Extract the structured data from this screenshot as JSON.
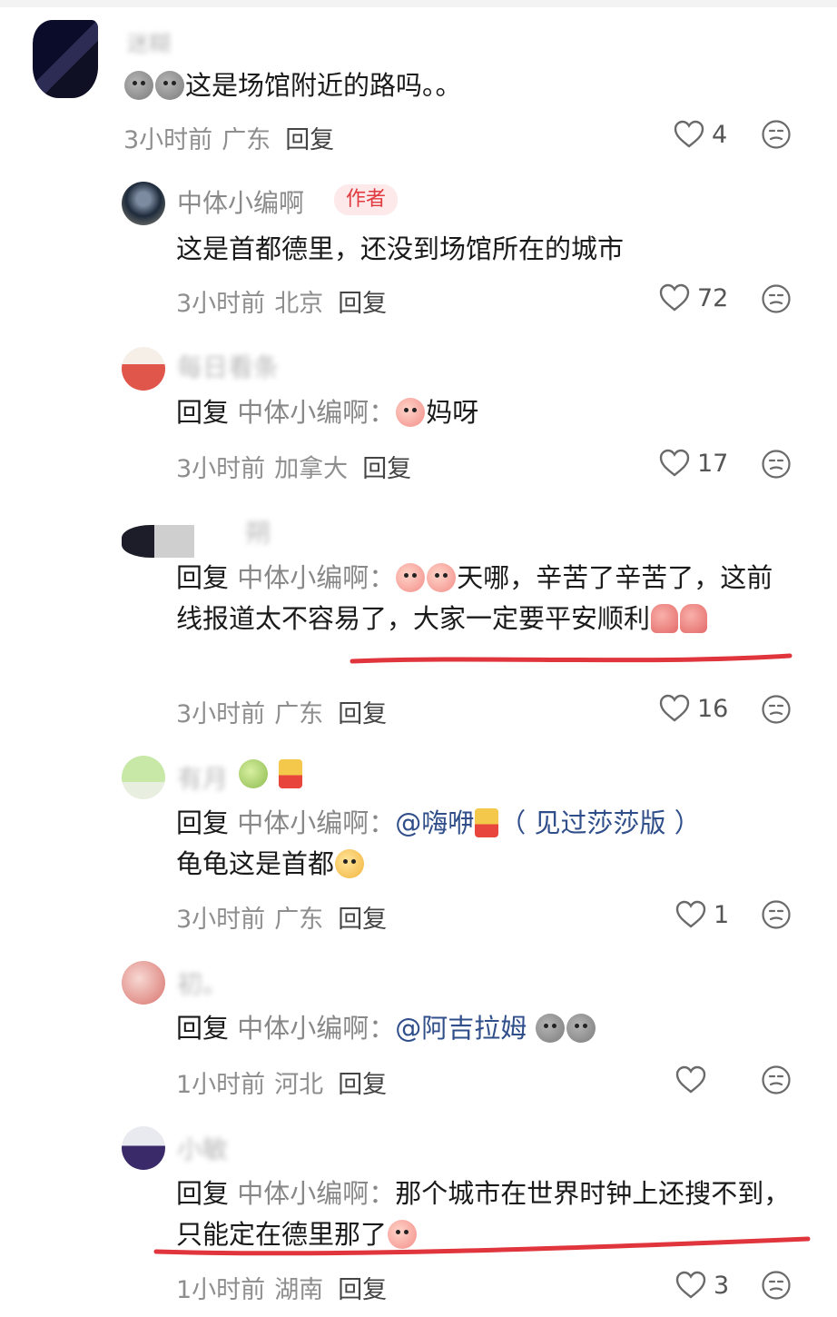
{
  "colors": {
    "like_icon": "#6a6a6a",
    "author_badge_text": "#e0393e",
    "mention": "#2f4e8a",
    "underline": "#e0353c"
  },
  "comments": [
    {
      "name": "迷糊",
      "content": "这是场馆附近的路吗。。",
      "time": "3小时前",
      "region": "广东",
      "reply_label": "回复",
      "likes": "4"
    },
    {
      "name": "中体小编啊",
      "badge": "作者",
      "content": "这是首都德里，还没到场馆所在的城市",
      "time": "3小时前",
      "region": "北京",
      "reply_label": "回复",
      "likes": "72"
    },
    {
      "name": "每日看条",
      "prefix": "回复",
      "target": "中体小编啊：",
      "content": "妈呀",
      "time": "3小时前",
      "region": "加拿大",
      "reply_label": "回复",
      "likes": "17"
    },
    {
      "name": "朔",
      "prefix": "回复",
      "target": "中体小编啊：",
      "content": "天哪，辛苦了辛苦了，这前线报道太不容易了，大家一定要平安顺利",
      "time": "3小时前",
      "region": "广东",
      "reply_label": "回复",
      "likes": "16"
    },
    {
      "name": "有月",
      "prefix": "回复",
      "target": "中体小编啊：",
      "mention": "@嗨咿",
      "content_a": "（ 见过莎莎版 ）",
      "content_b": "龟龟这是首都",
      "time": "3小时前",
      "region": "广东",
      "reply_label": "回复",
      "likes": "1"
    },
    {
      "name": "初。",
      "prefix": "回复",
      "target": "中体小编啊：",
      "mention": "@阿吉拉姆",
      "time": "1小时前",
      "region": "河北",
      "reply_label": "回复",
      "likes": ""
    },
    {
      "name": "小敏",
      "prefix": "回复",
      "target": "中体小编啊：",
      "content": "那个城市在世界时钟上还搜不到，只能定在德里那了",
      "time": "1小时前",
      "region": "湖南",
      "reply_label": "回复",
      "likes": "3"
    }
  ]
}
